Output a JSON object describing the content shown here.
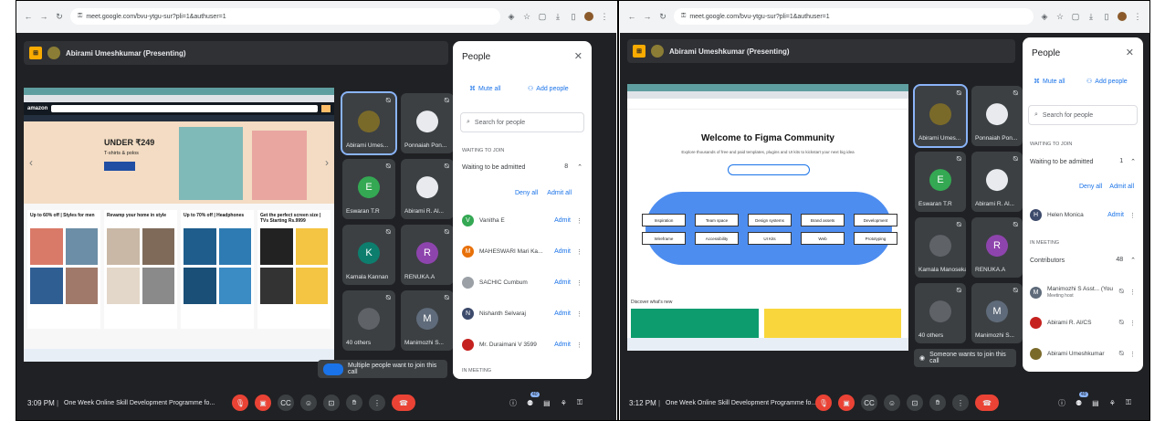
{
  "left": {
    "url": "meet.google.com/bvu-ytgu-sur?pli=1&authuser=1",
    "presenter": "Abirami Umeshkumar (Presenting)",
    "share": {
      "headline": "UNDER ₹249",
      "sub": "T-shirts & polos",
      "cards": [
        "Up to 60% off | Styles for men",
        "Revamp your home in style",
        "Up to 70% off | Headphones",
        "Get the perfect screen size | TVs Starting Rs.9999"
      ]
    },
    "tiles": [
      {
        "name": "Abirami Umes...",
        "initial": "",
        "color": "#7a6a2a"
      },
      {
        "name": "Ponnaiah Pon...",
        "initial": "",
        "color": "#e8eaed"
      },
      {
        "name": "Eswaran T.R",
        "initial": "E",
        "color": "#34a853"
      },
      {
        "name": "Abirami R. Al...",
        "initial": "",
        "color": "#e8eaed"
      },
      {
        "name": "Kamala Kannan",
        "initial": "K",
        "color": "#0d7e6e"
      },
      {
        "name": "RENUKA.A",
        "initial": "R",
        "color": "#8e44ad"
      },
      {
        "name": "40 others",
        "initial": "",
        "color": "#5f6368"
      },
      {
        "name": "Manimozhi S...",
        "initial": "M",
        "color": "#5f6b7a"
      }
    ],
    "people": {
      "title": "People",
      "mute": "Mute all",
      "add": "Add people",
      "search": "Search for people",
      "waiting_head": "WAITING TO JOIN",
      "waiting_label": "Waiting to be admitted",
      "waiting_count": "8",
      "deny": "Deny all",
      "admit_all": "Admit all",
      "rows": [
        {
          "name": "Vanitha E",
          "initial": "V",
          "color": "#34a853"
        },
        {
          "name": "MAHESWARI Mari Ka...",
          "initial": "M",
          "color": "#e8710a"
        },
        {
          "name": "SACHIC Cumbum",
          "initial": "",
          "color": "#9aa0a6"
        },
        {
          "name": "Nishanth Selvaraj",
          "initial": "N",
          "color": "#3c4a6b"
        },
        {
          "name": "Mr. Duraimani V 3599",
          "initial": "",
          "color": "#c5221f"
        }
      ],
      "admit": "Admit",
      "foot": "IN MEETING"
    },
    "toast": "Multiple people want to join this call",
    "time": "3:09 PM",
    "meeting": "One Week Online Skill Development Programme fo...",
    "badge": "40"
  },
  "right": {
    "url": "meet.google.com/bvu-ytgu-sur?pli=1&authuser=1",
    "presenter": "Abirami Umeshkumar (Presenting)",
    "share": {
      "title": "Welcome to Figma Community",
      "sub": "Explore thousands of free and paid templates, plugins and UI kits to kickstart your next big idea",
      "nodes": [
        "Inspiration",
        "Team space",
        "Design systems",
        "Brand assets",
        "Development"
      ],
      "nodes2": [
        "Wireframe",
        "Accessibility",
        "UI Kits",
        "Web",
        "Prototyping"
      ],
      "discover": "Discover what's new"
    },
    "tiles": [
      {
        "name": "Abirami Umes...",
        "initial": "",
        "color": "#7a6a2a"
      },
      {
        "name": "Ponnaiah Pon...",
        "initial": "",
        "color": "#e8eaed"
      },
      {
        "name": "Eswaran T.R",
        "initial": "E",
        "color": "#34a853"
      },
      {
        "name": "Abirami R. Al...",
        "initial": "",
        "color": "#e8eaed"
      },
      {
        "name": "Kamala Manosekaran",
        "initial": "",
        "color": "#5f6368"
      },
      {
        "name": "RENUKA.A",
        "initial": "R",
        "color": "#8e44ad"
      },
      {
        "name": "40 others",
        "initial": "",
        "color": "#5f6368"
      },
      {
        "name": "Manimozhi S...",
        "initial": "M",
        "color": "#5f6b7a"
      }
    ],
    "people": {
      "title": "People",
      "mute": "Mute all",
      "add": "Add people",
      "search": "Search for people",
      "waiting_head": "WAITING TO JOIN",
      "waiting_label": "Waiting to be admitted",
      "waiting_count": "1",
      "deny": "Deny all",
      "admit_all": "Admit all",
      "waiting_rows": [
        {
          "name": "Helen Monica",
          "initial": "H",
          "color": "#3c4a6b"
        }
      ],
      "meeting_head": "IN MEETING",
      "contributors": "Contributors",
      "contrib_count": "48",
      "rows": [
        {
          "name": "Manimozhi S Asst... (You)",
          "sub": "Meeting host",
          "initial": "M",
          "color": "#5f6b7a"
        },
        {
          "name": "Abirami R. Al/CS",
          "sub": "",
          "initial": "",
          "color": "#c5221f"
        },
        {
          "name": "Abirami Umeshkumar",
          "sub": "",
          "initial": "",
          "color": "#7a6a2a"
        }
      ],
      "admit": "Admit"
    },
    "toast": "Someone wants to join this call",
    "time": "3:12 PM",
    "meeting": "One Week Online Skill Development Programme fo...",
    "badge": "49"
  },
  "icons": {
    "mic": "mic-icon",
    "cam": "camera-icon",
    "cc": "captions-icon",
    "emoji": "emoji-icon",
    "present": "present-icon",
    "hand": "raise-hand-icon",
    "more": "more-icon",
    "end": "end-call-icon"
  }
}
